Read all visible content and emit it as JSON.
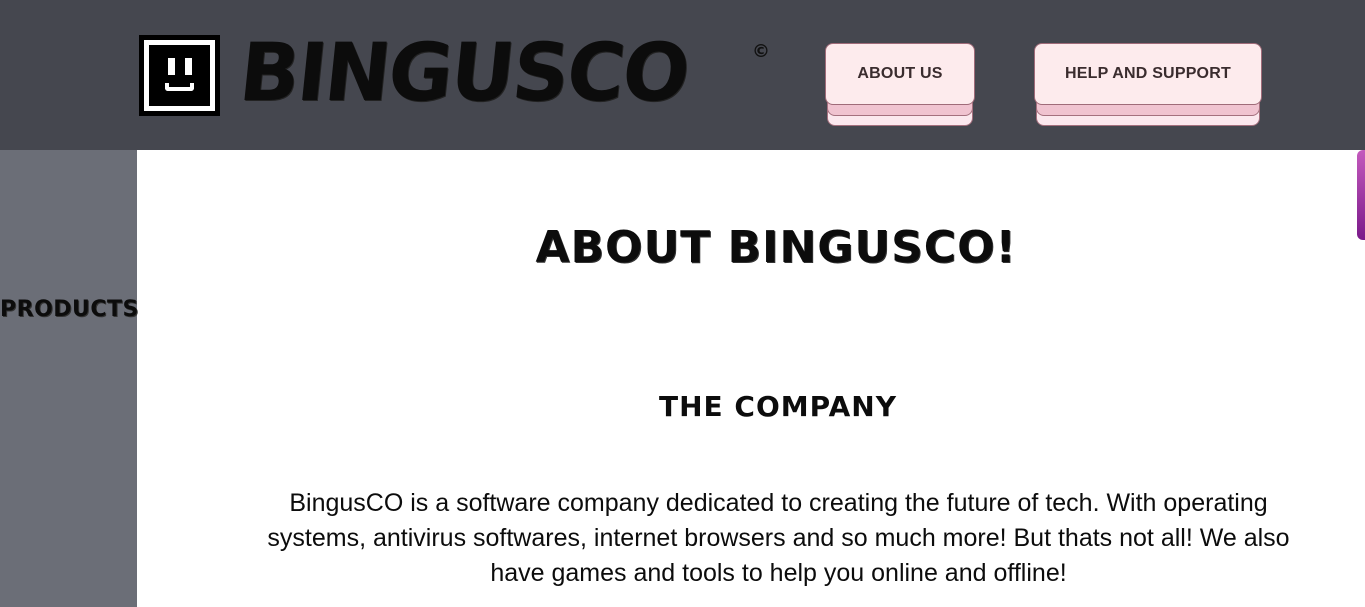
{
  "header": {
    "brand": "BINGUSCO",
    "copyright_mark": "©",
    "nav": {
      "about_label": "ABOUT US",
      "help_label": "HELP AND SUPPORT"
    }
  },
  "sidebar": {
    "products_label": "PRODUCTS"
  },
  "main": {
    "title": "ABOUT BINGUSCO!",
    "section_heading": "THE COMPANY",
    "body": "BingusCO is a software company dedicated to creating the future of tech. With operating systems, antivirus softwares, internet browsers and so much more! But thats not all! We also have games and tools to help you online and offline!"
  },
  "colors": {
    "header_bg": "#45474f",
    "sidebar_bg": "#6b6e77",
    "button_face": "#fdebed",
    "button_shadow": "#f0c3d0",
    "scroll_accent": "#8a1f96"
  },
  "icons": {
    "logo": "smiley-face-square-icon"
  }
}
